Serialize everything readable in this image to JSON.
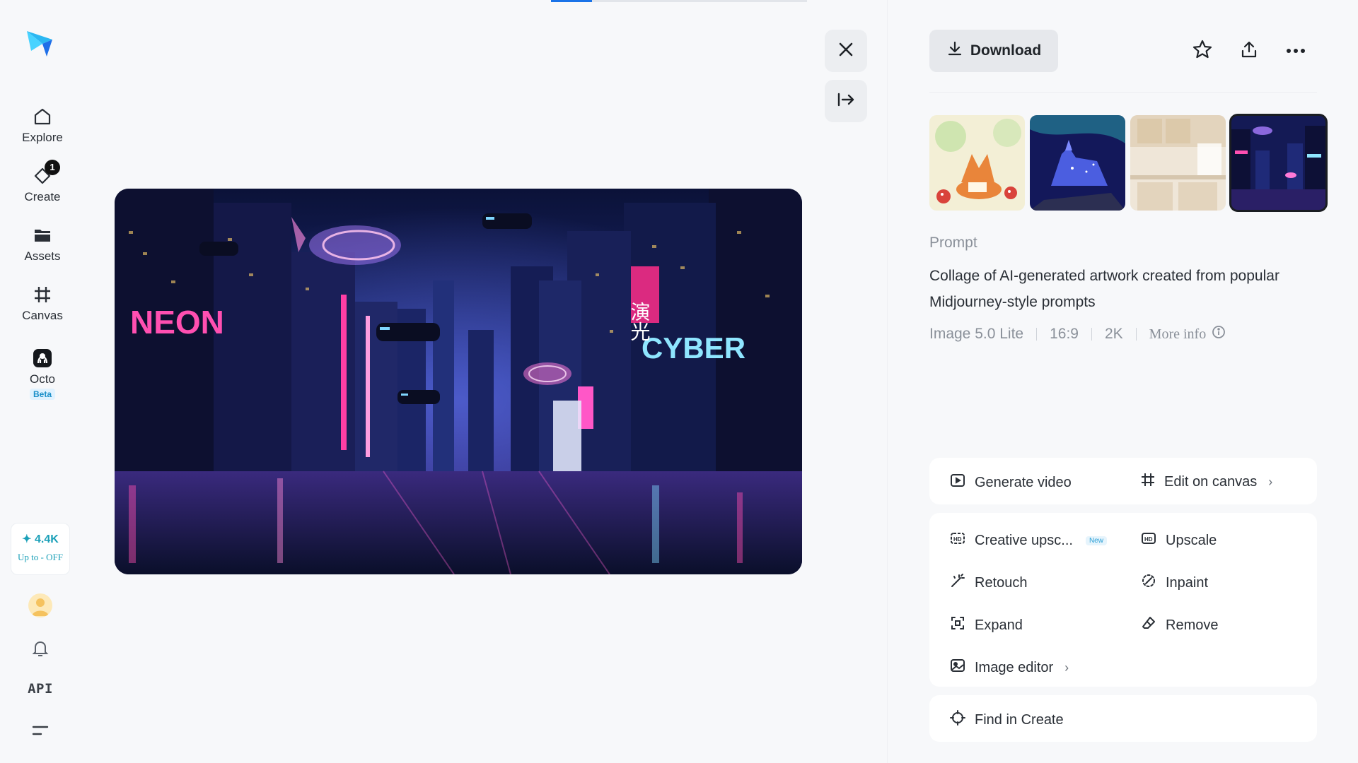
{
  "progress": {
    "fraction": 0.16
  },
  "sidebar": {
    "items": [
      {
        "label": "Explore",
        "icon": "home-icon"
      },
      {
        "label": "Create",
        "icon": "create-icon",
        "badge": "1"
      },
      {
        "label": "Assets",
        "icon": "folder-icon"
      },
      {
        "label": "Canvas",
        "icon": "canvas-icon"
      },
      {
        "label": "Octo",
        "icon": "octo-icon",
        "tag": "Beta"
      }
    ],
    "credits": {
      "amount": "✦ 4.4K",
      "promo": "Up to - OFF"
    },
    "api_label": "API"
  },
  "main_image": {
    "signs": {
      "left": "NEON",
      "right": "CYBER",
      "kanji": "演光"
    }
  },
  "panel": {
    "download_label": "Download",
    "prompt_label": "Prompt",
    "prompt_text": "Collage of AI-generated artwork created from popular Midjourney-style prompts",
    "meta": {
      "model": "Image 5.0 Lite",
      "ratio": "16:9",
      "resolution": "2K",
      "more_info": "More info"
    },
    "primary_actions": {
      "generate_video": "Generate video",
      "edit_on_canvas": "Edit on canvas"
    },
    "tools": {
      "creative_upscale": "Creative upsc...",
      "new_tag": "New",
      "upscale": "Upscale",
      "retouch": "Retouch",
      "inpaint": "Inpaint",
      "expand": "Expand",
      "remove": "Remove",
      "image_editor": "Image editor"
    },
    "find_in_create": "Find in Create"
  },
  "colors": {
    "accent": "#1a73e8",
    "credits": "#1ba0b8",
    "neon_pink": "#ff2e8a",
    "neon_cyan": "#38d8ff"
  }
}
